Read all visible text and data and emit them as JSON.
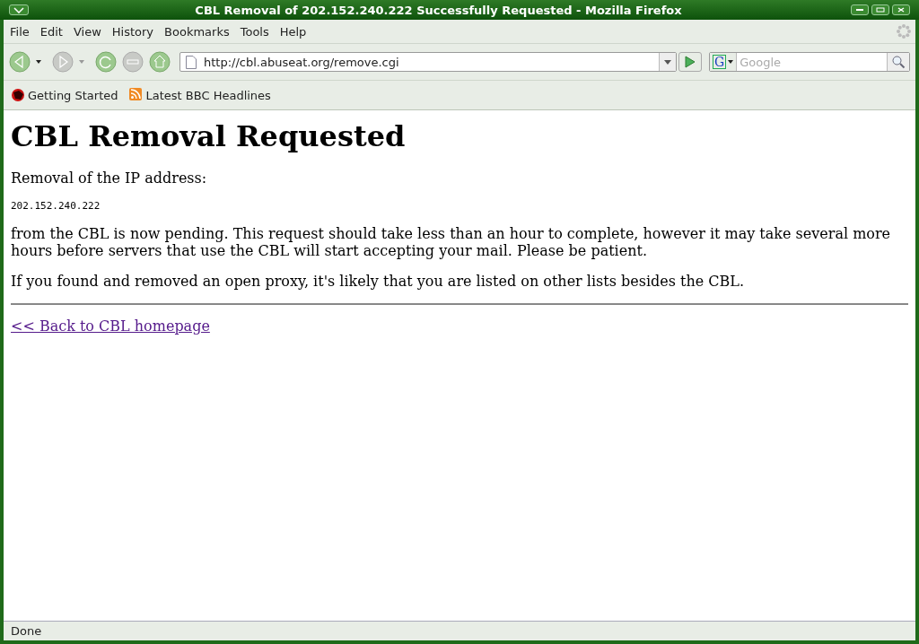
{
  "window": {
    "title": "CBL Removal of 202.152.240.222 Successfully Requested - Mozilla Firefox"
  },
  "menu": [
    "File",
    "Edit",
    "View",
    "History",
    "Bookmarks",
    "Tools",
    "Help"
  ],
  "nav_buttons": [
    {
      "kind": "back",
      "disabled": false,
      "dropdown": true
    },
    {
      "kind": "forward",
      "disabled": true,
      "dropdown": true
    },
    {
      "kind": "reload",
      "disabled": false,
      "dropdown": false
    },
    {
      "kind": "stop",
      "disabled": true,
      "dropdown": false
    },
    {
      "kind": "home",
      "disabled": false,
      "dropdown": false
    }
  ],
  "address": {
    "value": "http://cbl.abuseat.org/remove.cgi"
  },
  "search": {
    "engine_glyph": "G",
    "placeholder": "Google"
  },
  "bookmarks": [
    {
      "kind": "firefox",
      "label": "Getting Started"
    },
    {
      "kind": "feed",
      "label": "Latest BBC Headlines"
    }
  ],
  "page": {
    "heading": "CBL Removal Requested",
    "intro": "Removal of the IP address:",
    "ip": "202.152.240.222",
    "paragraphs": [
      "from the CBL is now pending. This request should take less than an hour to complete, however it may take several more hours before servers that use the CBL will start accepting your mail. Please be patient.",
      "If you found and removed an open proxy, it's likely that you are listed on other lists besides the CBL."
    ],
    "link": "<< Back to CBL homepage"
  },
  "status_bar": {
    "text": "Done"
  }
}
